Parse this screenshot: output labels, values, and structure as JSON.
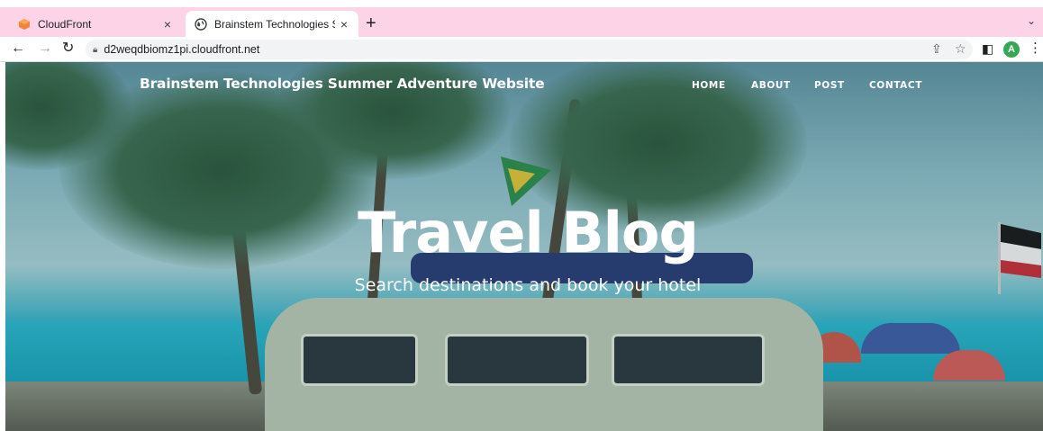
{
  "browser": {
    "tabs": [
      {
        "title": "CloudFront",
        "favicon": "cloudfront-icon",
        "close": "×"
      },
      {
        "title": "Brainstem Technologies Summ",
        "favicon": "globe-icon",
        "close": "×"
      }
    ],
    "new_tab": "+",
    "tab_menu": "⌄",
    "url": "d2weqdbiomz1pi.cloudfront.net",
    "avatar_letter": "A",
    "colors": {
      "tabbar": "#fcd3e7",
      "avatar": "#34a853",
      "cloudfront_orange": "#f58536"
    }
  },
  "site": {
    "brand": "Brainstem Technologies Summer Adventure Website",
    "nav": [
      "HOME",
      "ABOUT",
      "POST",
      "CONTACT"
    ],
    "hero_title": "Travel Blog",
    "hero_subtitle": "Search destinations and book your hotel"
  }
}
